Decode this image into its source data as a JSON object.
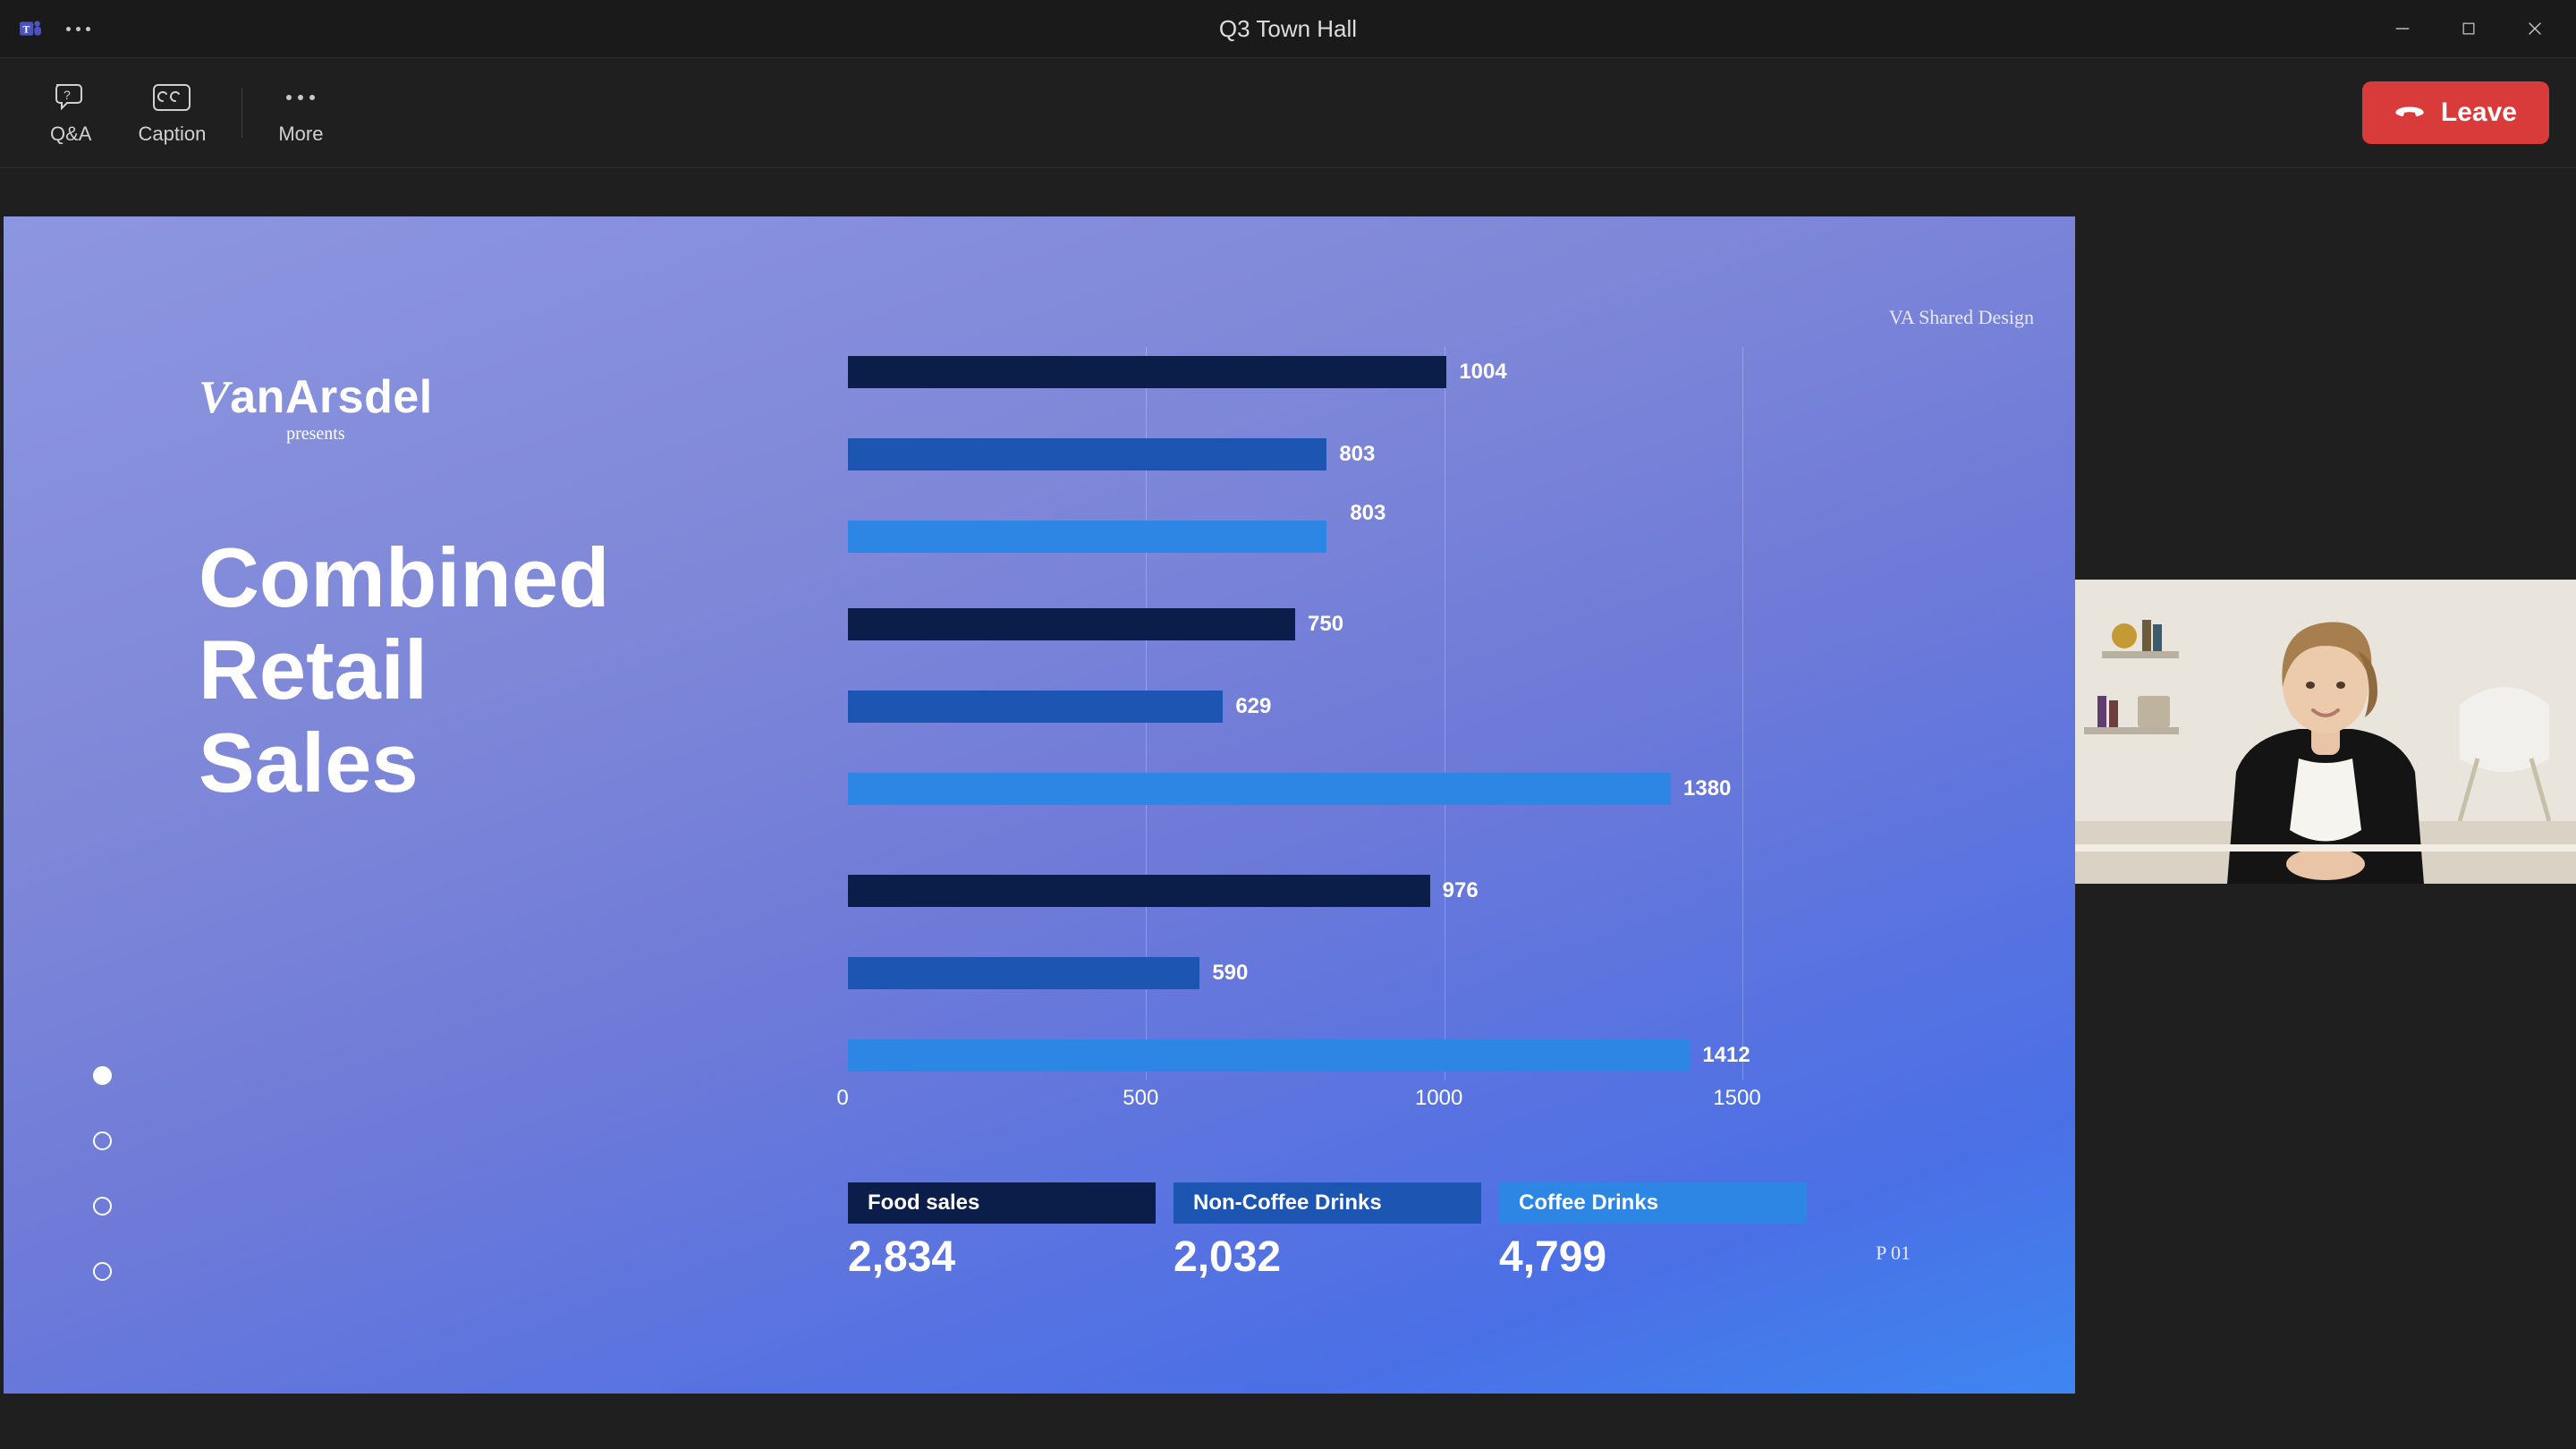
{
  "app": {
    "title": "Q3 Town Hall"
  },
  "toolbar": {
    "qa_label": "Q&A",
    "caption_label": "Caption",
    "more_label": "More",
    "leave_label": "Leave"
  },
  "slide": {
    "brand_name": "VanArsdel",
    "brand_presents": "presents",
    "title_line1": "Combined",
    "title_line2": "Retail",
    "title_line3": "Sales",
    "header_tag": "VA Shared Design",
    "page_number": "P 01"
  },
  "legend": {
    "items": [
      {
        "label": "Food sales",
        "total": "2,834"
      },
      {
        "label": "Non-Coffee Drinks",
        "total": "2,032"
      },
      {
        "label": "Coffee Drinks",
        "total": "4,799"
      }
    ]
  },
  "axis_ticks": [
    "0",
    "500",
    "1000",
    "1500"
  ],
  "chart_data": {
    "type": "bar",
    "orientation": "horizontal",
    "xlabel": "",
    "ylabel": "",
    "xlim": [
      0,
      1500
    ],
    "grid": true,
    "series": [
      {
        "name": "Food sales",
        "color": "#0b1e49",
        "values": [
          1004,
          750,
          976
        ]
      },
      {
        "name": "Non-Coffee Drinks",
        "color": "#1c55b2",
        "values": [
          803,
          629,
          590
        ]
      },
      {
        "name": "Coffee Drinks",
        "color": "#2d86e3",
        "values": [
          803,
          1380,
          1412
        ]
      }
    ],
    "series_totals": [
      2834,
      2032,
      4799
    ],
    "value_labels": {
      "group1": [
        1004,
        803,
        803
      ],
      "group2": [
        750,
        629,
        1380
      ],
      "group3": [
        976,
        590,
        1412
      ]
    },
    "axis_ticks": [
      0,
      500,
      1000,
      1500
    ]
  }
}
